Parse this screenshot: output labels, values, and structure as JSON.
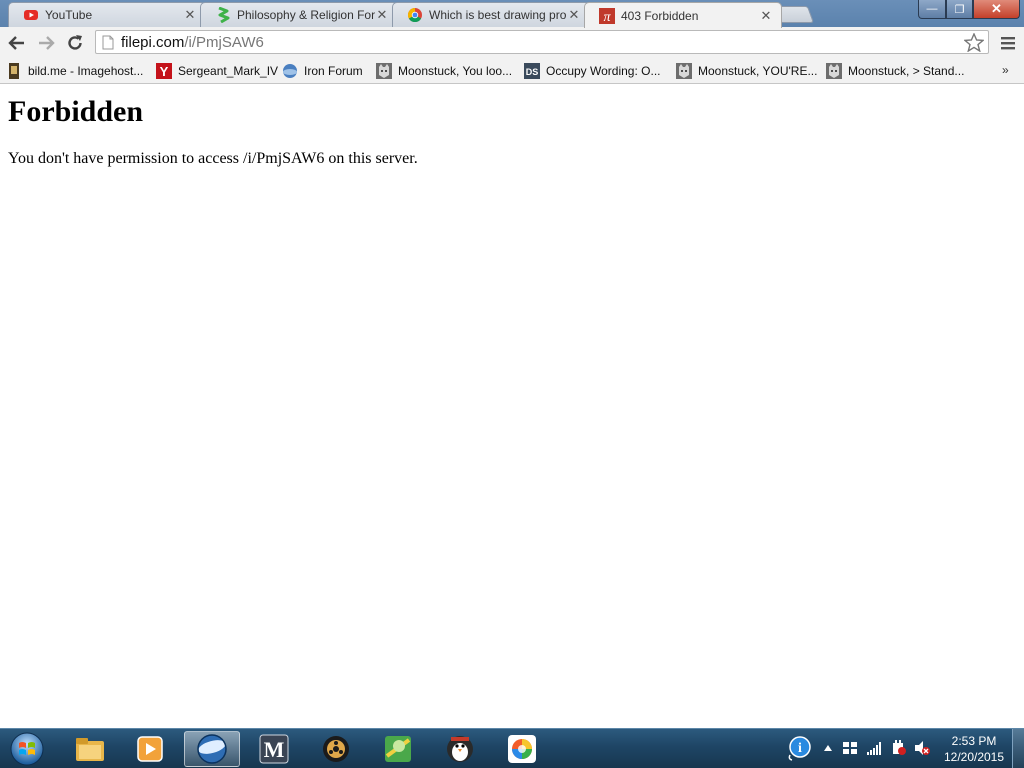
{
  "tabs": [
    {
      "title": "YouTube",
      "icon": "youtube-icon",
      "close": "✕"
    },
    {
      "title": "Philosophy & Religion For",
      "icon": "green-squiggle-icon",
      "close": "✕"
    },
    {
      "title": "Which is best drawing pro",
      "icon": "chrome-icon",
      "close": "✕"
    },
    {
      "title": "403 Forbidden",
      "icon": "pi-icon",
      "close": "✕"
    }
  ],
  "window_controls": {
    "minimize": "—",
    "maximize": "❐",
    "close": "✕"
  },
  "address": {
    "host": "filepi.com",
    "path": "/i/PmjSAW6"
  },
  "bookmarks": [
    {
      "label": "bild.me - Imagehost...",
      "icon": "bild-me-icon"
    },
    {
      "label": "Sergeant_Mark_IV",
      "icon": "youtube-y-icon"
    },
    {
      "label": "Iron Forum",
      "icon": "iron-forum-icon"
    },
    {
      "label": "Moonstuck, You loo...",
      "icon": "wolf-icon"
    },
    {
      "label": "Occupy Wording: O...",
      "icon": "deviantart-icon"
    },
    {
      "label": "Moonstuck, YOU'RE...",
      "icon": "wolf-icon"
    },
    {
      "label": "Moonstuck, > Stand...",
      "icon": "wolf-icon"
    }
  ],
  "bookmarks_overflow": "»",
  "page": {
    "heading": "Forbidden",
    "message": "You don't have permission to access /i/PmjSAW6 on this server."
  },
  "taskbar": {
    "apps": [
      {
        "name": "file-explorer-icon"
      },
      {
        "name": "media-player-icon"
      },
      {
        "name": "browser-orb-icon"
      },
      {
        "name": "m-app-icon"
      },
      {
        "name": "steam-like-icon"
      },
      {
        "name": "map-app-icon"
      },
      {
        "name": "penguin-app-icon"
      },
      {
        "name": "paint-app-icon"
      }
    ],
    "clock": {
      "time": "2:53 PM",
      "date": "12/20/2015"
    }
  },
  "colors": {
    "taskbar": "#1e4565",
    "titlebar": "#5b82ad",
    "toolbar": "#f2f2f2"
  }
}
